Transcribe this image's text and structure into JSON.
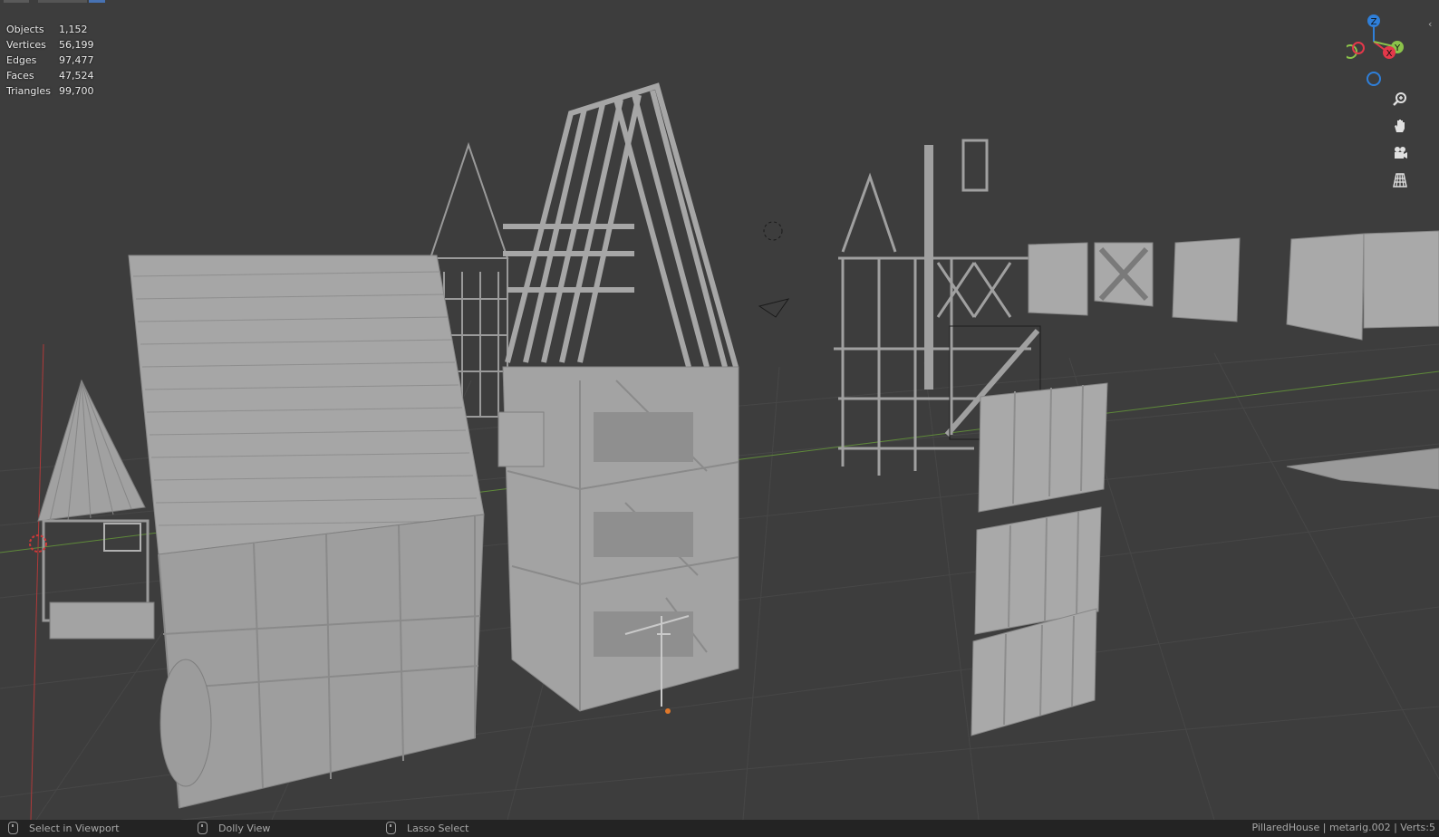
{
  "stats": [
    {
      "label": "Objects",
      "value": "1,152"
    },
    {
      "label": "Vertices",
      "value": "56,199"
    },
    {
      "label": "Edges",
      "value": "97,477"
    },
    {
      "label": "Faces",
      "value": "47,524"
    },
    {
      "label": "Triangles",
      "value": "99,700"
    }
  ],
  "gizmo": {
    "z": "Z",
    "y": "Y",
    "x": "X"
  },
  "nav_buttons": [
    "zoom-icon",
    "hand-pan-icon",
    "camera-icon",
    "grid-ortho-icon"
  ],
  "statusbar": {
    "select": "Select in Viewport",
    "dolly": "Dolly View",
    "lasso": "Lasso Select",
    "right": "PillaredHouse | metarig.002 | Verts:5"
  },
  "colors": {
    "viewport_bg": "#3d3d3d",
    "mesh": "#a3a3a3",
    "axis_x": "#e4384a",
    "axis_y": "#8bc34a",
    "axis_z": "#2f7fd9"
  }
}
